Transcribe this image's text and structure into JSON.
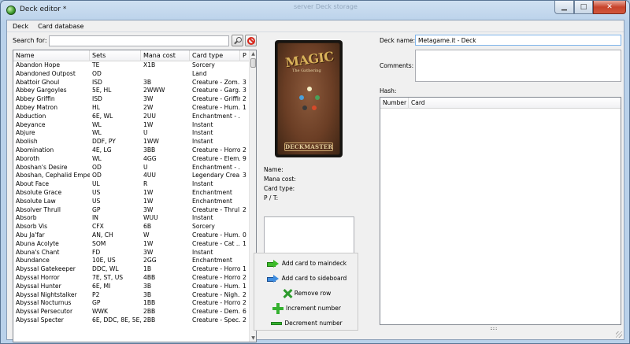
{
  "window": {
    "title": "Deck editor *",
    "background_title": "server Deck storage",
    "controls": {
      "minimize": "▁",
      "maximize": "□",
      "close": "✕"
    }
  },
  "menu": [
    "Deck",
    "Card database"
  ],
  "search": {
    "label": "Search for:",
    "value": "",
    "placeholder": ""
  },
  "card_table": {
    "columns": [
      "Name",
      "Sets",
      "Mana cost",
      "Card type",
      "P"
    ],
    "rows": [
      [
        "Abandon Hope",
        "TE",
        "X1B",
        "Sorcery",
        ""
      ],
      [
        "Abandoned Outpost",
        "OD",
        "",
        "Land",
        ""
      ],
      [
        "Abattoir Ghoul",
        "ISD",
        "3B",
        "Creature - Zom...",
        "3"
      ],
      [
        "Abbey Gargoyles",
        "5E, HL",
        "2WWW",
        "Creature - Garg...",
        "3"
      ],
      [
        "Abbey Griffin",
        "ISD",
        "3W",
        "Creature - Griffin",
        "2"
      ],
      [
        "Abbey Matron",
        "HL",
        "2W",
        "Creature - Hum...",
        "1"
      ],
      [
        "Abduction",
        "6E, WL",
        "2UU",
        "Enchantment - ...",
        ""
      ],
      [
        "Abeyance",
        "WL",
        "1W",
        "Instant",
        ""
      ],
      [
        "Abjure",
        "WL",
        "U",
        "Instant",
        ""
      ],
      [
        "Abolish",
        "DDF, PY",
        "1WW",
        "Instant",
        ""
      ],
      [
        "Abomination",
        "4E, LG",
        "3BB",
        "Creature - Horror",
        "2"
      ],
      [
        "Aboroth",
        "WL",
        "4GG",
        "Creature - Elem...",
        "9"
      ],
      [
        "Aboshan's Desire",
        "OD",
        "U",
        "Enchantment - ...",
        ""
      ],
      [
        "Aboshan, Cephalid Emperor",
        "OD",
        "4UU",
        "Legendary Crea...",
        "3"
      ],
      [
        "About Face",
        "UL",
        "R",
        "Instant",
        ""
      ],
      [
        "Absolute Grace",
        "US",
        "1W",
        "Enchantment",
        ""
      ],
      [
        "Absolute Law",
        "US",
        "1W",
        "Enchantment",
        ""
      ],
      [
        "Absolver Thrull",
        "GP",
        "3W",
        "Creature - Thrul...",
        "2"
      ],
      [
        "Absorb",
        "IN",
        "WUU",
        "Instant",
        ""
      ],
      [
        "Absorb Vis",
        "CFX",
        "6B",
        "Sorcery",
        ""
      ],
      [
        "Abu Ja'far",
        "AN, CH",
        "W",
        "Creature - Hum...",
        "0"
      ],
      [
        "Abuna Acolyte",
        "SOM",
        "1W",
        "Creature - Cat ...",
        "1"
      ],
      [
        "Abuna's Chant",
        "FD",
        "3W",
        "Instant",
        ""
      ],
      [
        "Abundance",
        "10E, US",
        "2GG",
        "Enchantment",
        ""
      ],
      [
        "Abyssal Gatekeeper",
        "DDC, WL",
        "1B",
        "Creature - Horror",
        "1"
      ],
      [
        "Abyssal Horror",
        "7E, ST, US",
        "4BB",
        "Creature - Horror",
        "2"
      ],
      [
        "Abyssal Hunter",
        "6E, MI",
        "3B",
        "Creature - Hum...",
        "1"
      ],
      [
        "Abyssal Nightstalker",
        "P2",
        "3B",
        "Creature - Nigh...",
        "2"
      ],
      [
        "Abyssal Nocturnus",
        "GP",
        "1BB",
        "Creature - Horror",
        "2"
      ],
      [
        "Abyssal Persecutor",
        "WWK",
        "2BB",
        "Creature - Dem...",
        "6"
      ],
      [
        "Abyssal Specter",
        "6E, DDC, 8E, 5E, ...",
        "2BB",
        "Creature - Spec...",
        "2"
      ]
    ]
  },
  "card_view": {
    "image_logo": "MAGIC",
    "image_sub": "The Gathering",
    "image_bottom": "DECKMASTER",
    "fields": [
      "Name:",
      "Mana cost:",
      "Card type:",
      "P / T:"
    ]
  },
  "actions": [
    {
      "label": "Add card to maindeck",
      "icon": "arrow-right-green-icon"
    },
    {
      "label": "Add card to sideboard",
      "icon": "arrow-right-blue-icon"
    },
    {
      "label": "Remove row",
      "icon": "remove-x-icon"
    },
    {
      "label": "Increment number",
      "icon": "plus-icon"
    },
    {
      "label": "Decrement number",
      "icon": "minus-icon"
    }
  ],
  "deck": {
    "name_label": "Deck name:",
    "name_value": "Metagame.it - Deck",
    "comments_label": "Comments:",
    "hash_label": "Hash:",
    "columns": [
      "Number",
      "Card"
    ]
  }
}
